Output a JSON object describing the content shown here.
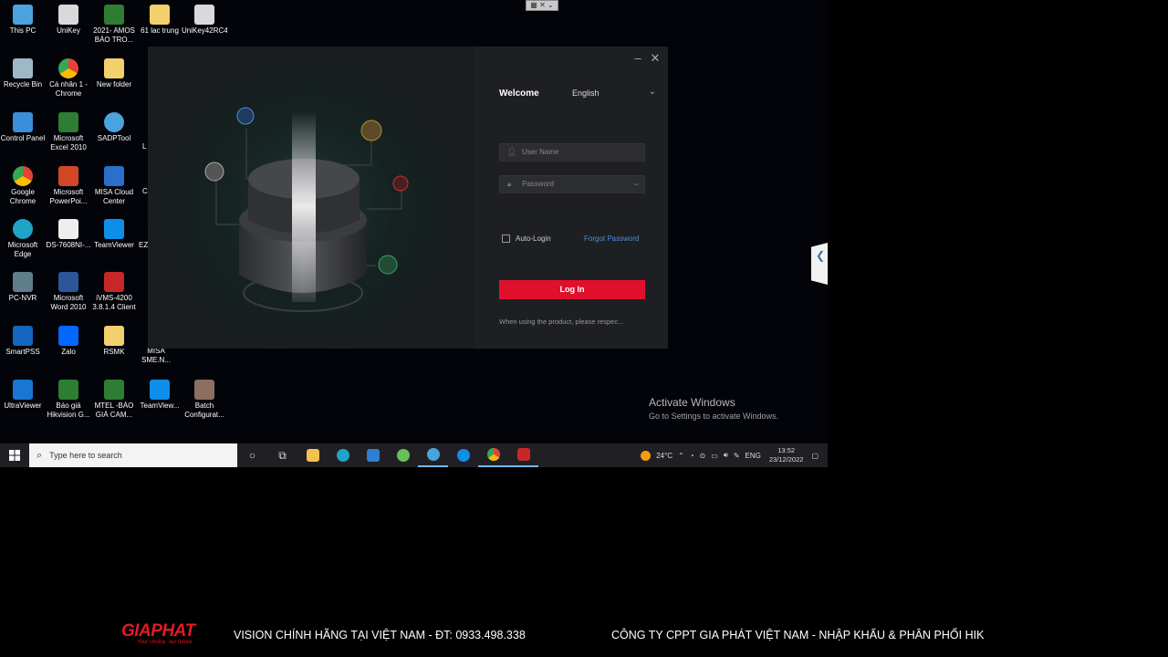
{
  "desktop": {
    "icons": [
      {
        "label": "This PC",
        "color": "#4aa3df"
      },
      {
        "label": "UniKey",
        "color": "#d9d9d9"
      },
      {
        "label": "2021- AMOS BÁO TRO...",
        "color": "#2e7d32"
      },
      {
        "label": "61 lac trung",
        "color": "#f2d06b"
      },
      {
        "label": "UniKey42RC4",
        "color": "#d9d9d9"
      },
      {
        "label": "Recycle Bin",
        "color": "#9fb8c8"
      },
      {
        "label": "Cá nhân 1 - Chrome",
        "color": "#e94235"
      },
      {
        "label": "New folder",
        "color": "#f2d06b"
      },
      {
        "label": "Control Panel",
        "color": "#3b8ed9"
      },
      {
        "label": "Microsoft Excel 2010",
        "color": "#2e7d32"
      },
      {
        "label": "SADPTool",
        "color": "#4aa3df"
      },
      {
        "label": "Google Chrome",
        "color": "#fbbc04"
      },
      {
        "label": "Microsoft PowerPoi...",
        "color": "#d24726"
      },
      {
        "label": "MISA Cloud Center",
        "color": "#2a6fc9"
      },
      {
        "label": "Microsoft Edge",
        "color": "#1fa3c7"
      },
      {
        "label": "DS-7608NI-...",
        "color": "#eeeeee"
      },
      {
        "label": "TeamViewer",
        "color": "#0e8ee9"
      },
      {
        "label": "PC-NVR",
        "color": "#607d8b"
      },
      {
        "label": "Microsoft Word 2010",
        "color": "#2b579a"
      },
      {
        "label": "iVMS-4200 3.8.1.4 Client",
        "color": "#c62828"
      },
      {
        "label": "SmartPSS",
        "color": "#1565c0"
      },
      {
        "label": "Zalo",
        "color": "#0068ff"
      },
      {
        "label": "RSMK",
        "color": "#f2d06b"
      },
      {
        "label": "MISA SME.N...",
        "color": "#1e5aa8"
      },
      {
        "label": "UltraViewer",
        "color": "#1976d2"
      },
      {
        "label": "Báo giá Hikvision G...",
        "color": "#2e7d32"
      },
      {
        "label": "MTEL -BÁO GIÁ CAM...",
        "color": "#2e7d32"
      },
      {
        "label": "TeamView...",
        "color": "#0e8ee9"
      },
      {
        "label": "Batch Configurat...",
        "color": "#8d6e63"
      }
    ],
    "cut_labels": [
      "L",
      "C",
      "EZ"
    ]
  },
  "login": {
    "welcome": "Welcome",
    "language": "English",
    "username_placeholder": "User Name",
    "password_placeholder": "Password",
    "auto_login": "Auto-Login",
    "forgot_password": "Forgot Password",
    "login_button": "Log In",
    "notice": "When using the product, please respec..."
  },
  "watermark": {
    "title": "Activate Windows",
    "subtitle": "Go to Settings to activate Windows."
  },
  "taskbar": {
    "search_placeholder": "Type here to search",
    "weather": "24°C",
    "language": "ENG",
    "time": "13:52",
    "date": "23/12/2022"
  },
  "banner": {
    "brand": "GIAPHAT",
    "brand_tagline": "Your choice, our future",
    "ticker_left": "VISION CHÍNH HÃNG TẠI VIỆT NAM - ĐT: 0933.498.338",
    "ticker_right": "CÔNG TY CPPT GIA PHÁT VIỆT NAM - NHẬP KHẨU & PHÂN PHỐI HIK"
  },
  "colors": {
    "accent_red": "#e0102c",
    "link_blue": "#4a90d9",
    "taskbar": "#202024"
  }
}
